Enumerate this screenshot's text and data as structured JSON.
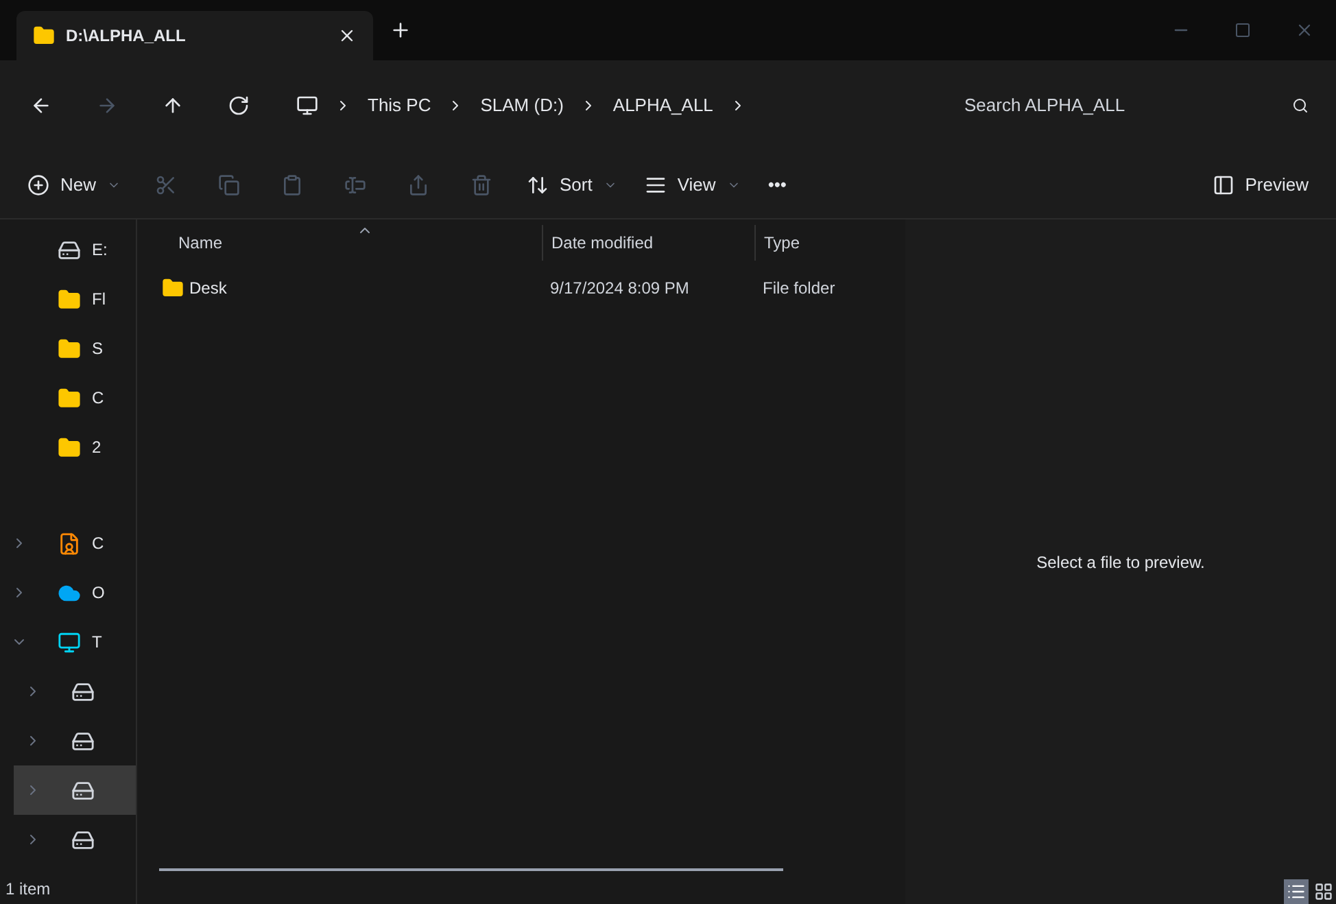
{
  "window": {
    "title": "D:\\ALPHA_ALL"
  },
  "nav": [
    {
      "kind": "back",
      "disabled": false
    },
    {
      "kind": "forward",
      "disabled": true
    },
    {
      "kind": "up",
      "disabled": false
    },
    {
      "kind": "refresh",
      "disabled": false
    }
  ],
  "breadcrumb": [
    "This PC",
    "SLAM (D:)",
    "ALPHA_ALL"
  ],
  "search": {
    "placeholder": "Search ALPHA_ALL"
  },
  "commands": [
    {
      "kind": "new",
      "label": "New",
      "disabled": false
    },
    {
      "kind": "cut",
      "disabled": true
    },
    {
      "kind": "copy",
      "disabled": true
    },
    {
      "kind": "paste",
      "disabled": true
    },
    {
      "kind": "rename",
      "disabled": true
    },
    {
      "kind": "share",
      "disabled": true
    },
    {
      "kind": "delete",
      "disabled": true
    },
    {
      "kind": "sort",
      "label": "Sort",
      "disabled": false
    },
    {
      "kind": "view",
      "label": "View",
      "disabled": false
    },
    {
      "kind": "more",
      "label": "•••",
      "disabled": false
    }
  ],
  "preview_button": {
    "label": "Preview"
  },
  "sidebar": {
    "pinned": [
      {
        "kind": "drive",
        "label": "E:"
      },
      {
        "kind": "folder",
        "label": "Fl"
      },
      {
        "kind": "folder",
        "label": "S"
      },
      {
        "kind": "folder",
        "label": "C"
      },
      {
        "kind": "folder",
        "label": "2"
      }
    ],
    "tree": [
      {
        "kind": "user",
        "label": "C",
        "expanded": false,
        "selected": false
      },
      {
        "kind": "cloud",
        "label": "O",
        "expanded": false,
        "selected": false
      },
      {
        "kind": "pc",
        "label": "T",
        "expanded": true,
        "selected": false,
        "children": [
          {
            "kind": "drive",
            "expanded": false,
            "selected": false
          },
          {
            "kind": "drive",
            "expanded": false,
            "selected": false
          },
          {
            "kind": "drive",
            "expanded": false,
            "selected": true
          },
          {
            "kind": "drive",
            "expanded": false,
            "selected": false
          }
        ]
      }
    ]
  },
  "table": {
    "columns": [
      "Name",
      "Date modified",
      "Type"
    ],
    "rows": [
      {
        "name": "Desk",
        "date": "9/17/2024 8:09 PM",
        "type": "File folder",
        "selected": false
      }
    ]
  },
  "preview": {
    "message": "Select a file to preview."
  },
  "status_bar": {
    "count": "1 item",
    "views": [
      {
        "kind": "details",
        "selected": true
      },
      {
        "kind": "tiles",
        "selected": false
      }
    ]
  }
}
